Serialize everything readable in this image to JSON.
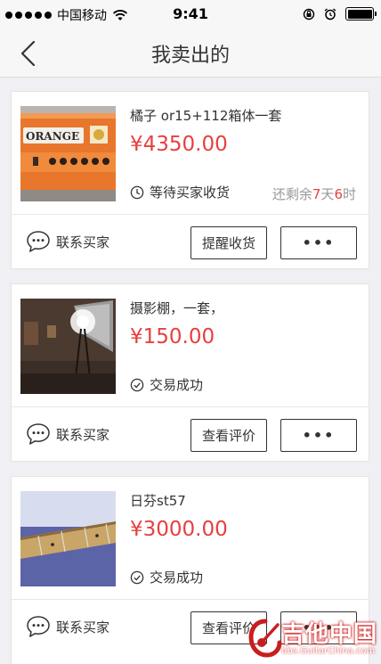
{
  "status_bar": {
    "carrier": "中国移动",
    "time": "9:41"
  },
  "nav": {
    "title": "我卖出的"
  },
  "orders": [
    {
      "title": "橘子 or15+112箱体一套",
      "price": "¥4350.00",
      "status": "等待买家收货",
      "status_icon": "clock-icon",
      "remain_prefix": "还剩余",
      "remain_days": "7",
      "remain_day_unit": "天",
      "remain_hours": "6",
      "remain_hour_unit": "时",
      "contact_label": "联系买家",
      "action_label": "提醒收货",
      "more_label": "•••",
      "thumb_text": "ORANGE"
    },
    {
      "title": "摄影棚，一套，",
      "price": "¥150.00",
      "status": "交易成功",
      "status_icon": "check-circle-icon",
      "contact_label": "联系买家",
      "action_label": "查看评价",
      "more_label": "•••"
    },
    {
      "title": "日芬st57",
      "price": "¥3000.00",
      "status": "交易成功",
      "status_icon": "check-circle-icon",
      "contact_label": "联系买家",
      "action_label": "查看评价",
      "more_label": "•••"
    }
  ],
  "watermark": {
    "text": "吉他中国",
    "sub": "bbs.GuitarChina.com"
  },
  "colors": {
    "price": "#e83f3f",
    "background": "#efeff4"
  }
}
